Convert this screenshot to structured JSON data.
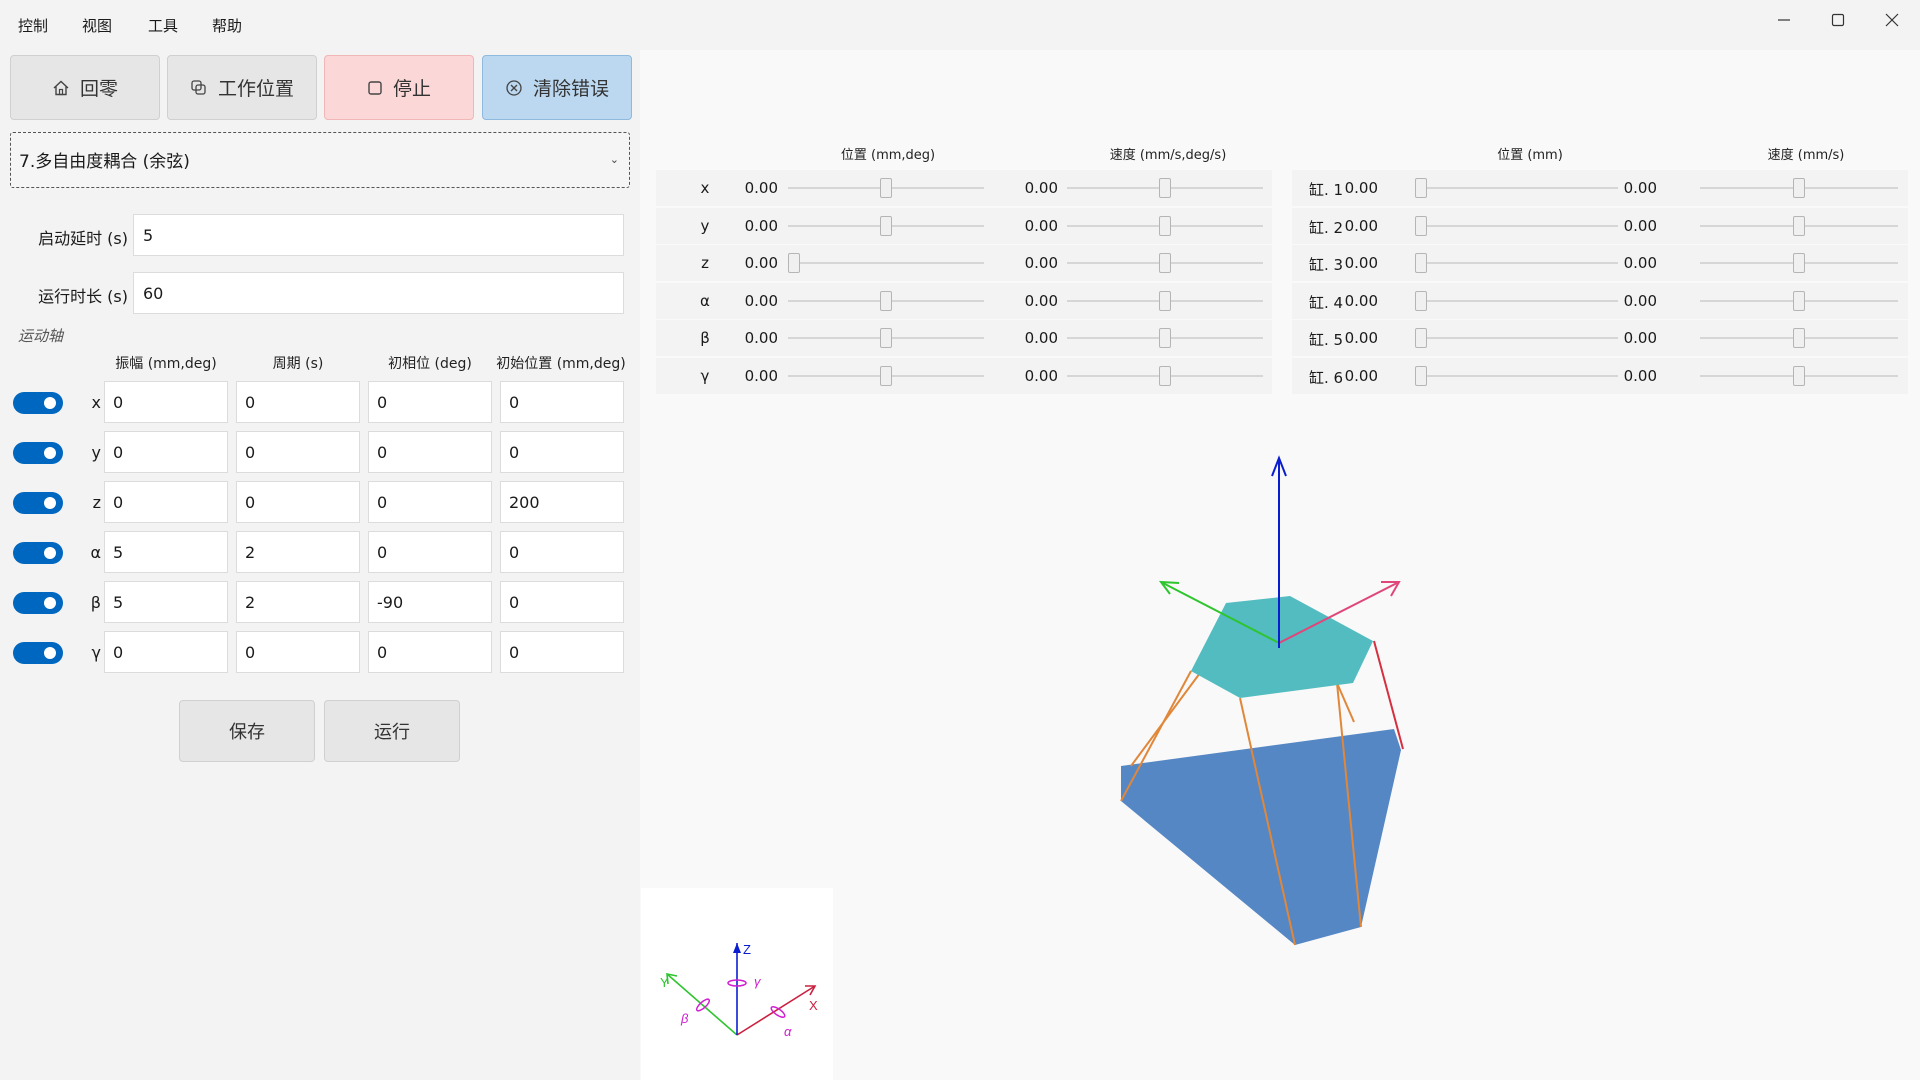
{
  "menu": {
    "items": [
      {
        "label": "控制"
      },
      {
        "label": "视图"
      },
      {
        "label": "工具"
      },
      {
        "label": "帮助"
      }
    ]
  },
  "toolbar": {
    "home_label": "回零",
    "work_position_label": "工作位置",
    "stop_label": "停止",
    "clear_errors_label": "清除错误"
  },
  "mode_select": {
    "value": "7.多自由度耦合 (余弦)"
  },
  "params": {
    "start_delay_label": "启动延时 (s)",
    "start_delay_value": "5",
    "run_duration_label": "运行时长 (s)",
    "run_duration_value": "60"
  },
  "axes_section": {
    "title": "运动轴",
    "headers": [
      "振幅 (mm,deg)",
      "周期 (s)",
      "初相位 (deg)",
      "初始位置 (mm,deg)"
    ],
    "rows": [
      {
        "axis": "x",
        "enabled": true,
        "amplitude": "0",
        "period": "0",
        "phase": "0",
        "initial": "0"
      },
      {
        "axis": "y",
        "enabled": true,
        "amplitude": "0",
        "period": "0",
        "phase": "0",
        "initial": "0"
      },
      {
        "axis": "z",
        "enabled": true,
        "amplitude": "0",
        "period": "0",
        "phase": "0",
        "initial": "200"
      },
      {
        "axis": "α",
        "enabled": true,
        "amplitude": "5",
        "period": "2",
        "phase": "0",
        "initial": "0"
      },
      {
        "axis": "β",
        "enabled": true,
        "amplitude": "5",
        "period": "2",
        "phase": "-90",
        "initial": "0"
      },
      {
        "axis": "γ",
        "enabled": true,
        "amplitude": "0",
        "period": "0",
        "phase": "0",
        "initial": "0"
      }
    ]
  },
  "actions": {
    "save_label": "保存",
    "run_label": "运行"
  },
  "pose_table": {
    "position_header": "位置 (mm,deg)",
    "speed_header": "速度 (mm/s,deg/s)",
    "rows": [
      {
        "label": "x",
        "position": "0.00",
        "position_level": 0.5,
        "speed": "0.00",
        "speed_level": 0.5
      },
      {
        "label": "y",
        "position": "0.00",
        "position_level": 0.5,
        "speed": "0.00",
        "speed_level": 0.5
      },
      {
        "label": "z",
        "position": "0.00",
        "position_level": 0.0,
        "speed": "0.00",
        "speed_level": 0.5
      },
      {
        "label": "α",
        "position": "0.00",
        "position_level": 0.5,
        "speed": "0.00",
        "speed_level": 0.5
      },
      {
        "label": "β",
        "position": "0.00",
        "position_level": 0.5,
        "speed": "0.00",
        "speed_level": 0.5
      },
      {
        "label": "γ",
        "position": "0.00",
        "position_level": 0.5,
        "speed": "0.00",
        "speed_level": 0.5
      }
    ]
  },
  "cylinder_table": {
    "position_header": "位置 (mm)",
    "speed_header": "速度 (mm/s)",
    "rows": [
      {
        "label": "缸. 1",
        "position": "0.00",
        "position_level": 0.0,
        "speed": "0.00",
        "speed_level": 0.5
      },
      {
        "label": "缸. 2",
        "position": "0.00",
        "position_level": 0.0,
        "speed": "0.00",
        "speed_level": 0.5
      },
      {
        "label": "缸. 3",
        "position": "0.00",
        "position_level": 0.0,
        "speed": "0.00",
        "speed_level": 0.5
      },
      {
        "label": "缸. 4",
        "position": "0.00",
        "position_level": 0.0,
        "speed": "0.00",
        "speed_level": 0.5
      },
      {
        "label": "缸. 5",
        "position": "0.00",
        "position_level": 0.0,
        "speed": "0.00",
        "speed_level": 0.5
      },
      {
        "label": "缸. 6",
        "position": "0.00",
        "position_level": 0.0,
        "speed": "0.00",
        "speed_level": 0.5
      }
    ]
  },
  "triad": {
    "x": "X",
    "y": "Y",
    "z": "Z",
    "alpha": "α",
    "beta": "β",
    "gamma": "γ"
  },
  "colors": {
    "accent": "#0067c0",
    "platform_top": "#52bcc0",
    "platform_base": "#5587c5",
    "leg_orange": "#e0873a",
    "leg_red": "#d43040",
    "axis_x": "#e0467a",
    "axis_y": "#2ec52e",
    "axis_z": "#0a1ed0",
    "rotation": "#d020d0"
  },
  "icons": {
    "home": "home-icon",
    "work_position": "work-position-icon",
    "stop": "stop-icon",
    "clear": "clear-error-icon"
  }
}
